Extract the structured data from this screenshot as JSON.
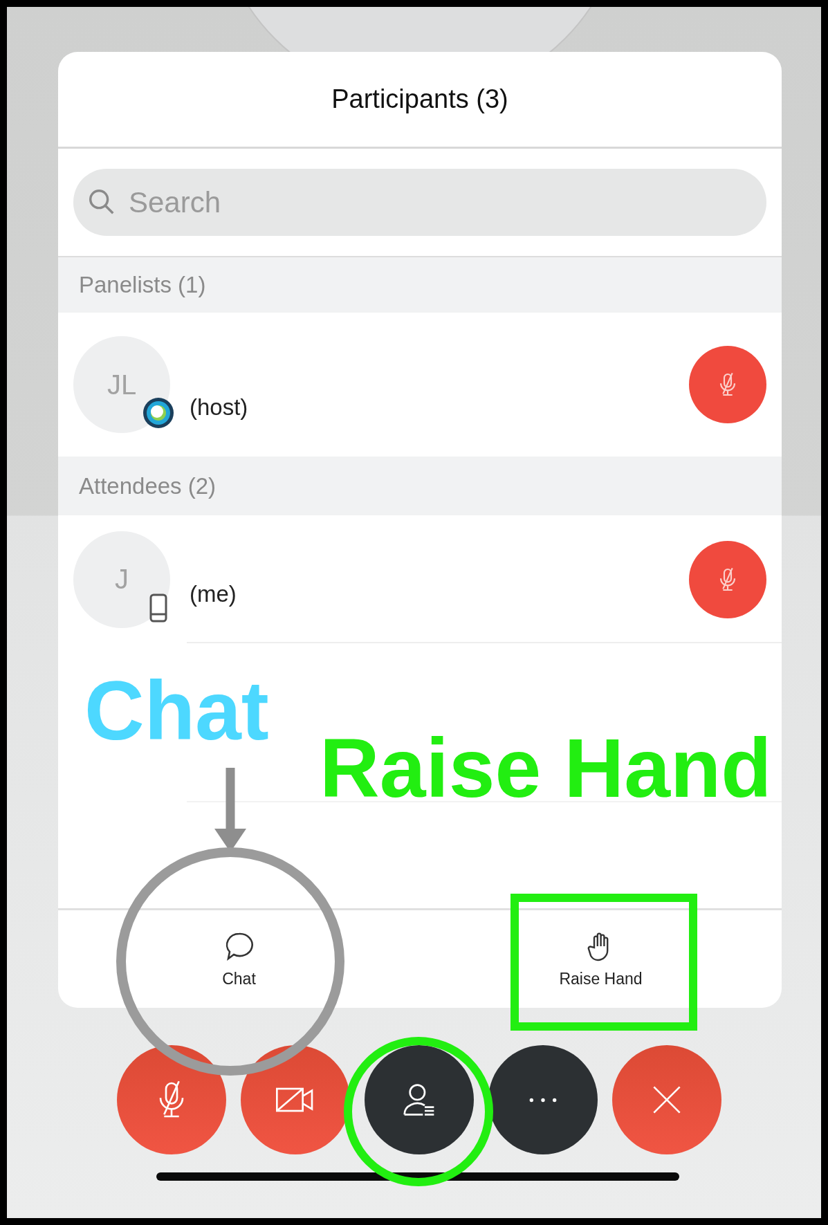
{
  "panel": {
    "title": "Participants (3)",
    "search": {
      "placeholder": "Search"
    },
    "sections": [
      {
        "title": "Panelists (1)",
        "participants": [
          {
            "initials": "JL",
            "role": "(host)",
            "mobile": false,
            "muted": true
          }
        ]
      },
      {
        "title": "Attendees (2)",
        "participants": [
          {
            "initials": "J",
            "role": "(me)",
            "mobile": true,
            "muted": true
          }
        ]
      }
    ],
    "actions": [
      {
        "kind": "chat",
        "label": "Chat"
      },
      {
        "kind": "raise_hand",
        "label": "Raise Hand"
      }
    ]
  },
  "controls": [
    {
      "kind": "mic",
      "on": false
    },
    {
      "kind": "video",
      "on": false
    },
    {
      "kind": "participants"
    },
    {
      "kind": "more"
    },
    {
      "kind": "leave"
    }
  ],
  "annotations": {
    "chat_label": "Chat",
    "raise_hand_label": "Raise Hand"
  }
}
